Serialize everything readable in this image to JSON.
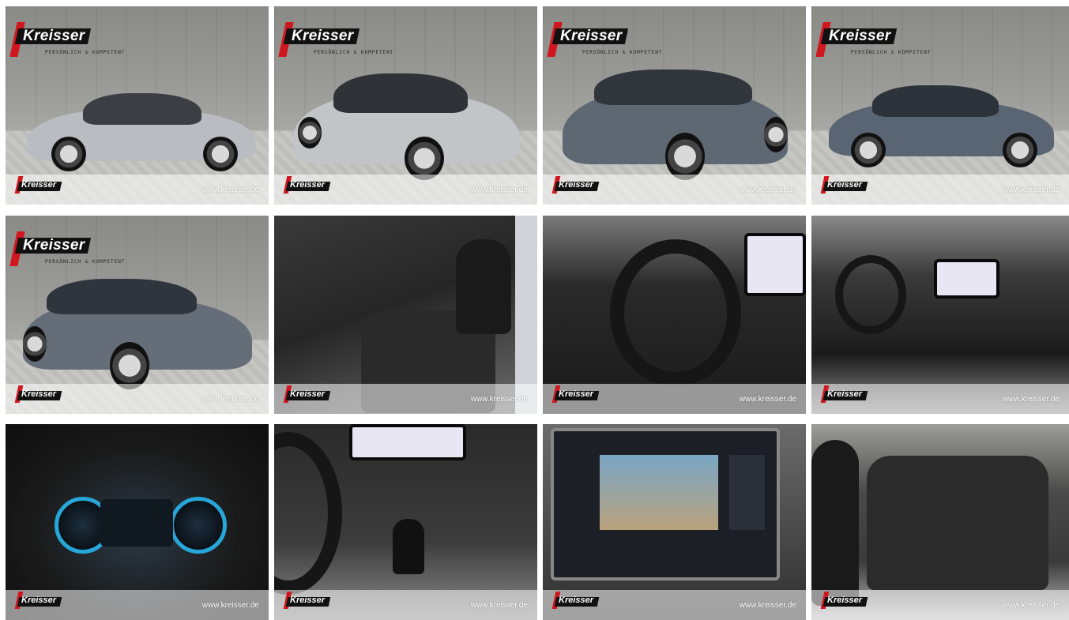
{
  "brand": {
    "logo_text": "Kreisser",
    "slogan": "PERSÖNLICH & KOMPETENT",
    "website": "www.kreisser.de",
    "colors": {
      "red": "#d0161f",
      "black": "#111111"
    }
  },
  "gallery": {
    "tiles": [
      {
        "label": "exterior-side-left"
      },
      {
        "label": "exterior-rear-left"
      },
      {
        "label": "exterior-rear-right"
      },
      {
        "label": "exterior-side-right"
      },
      {
        "label": "exterior-front-left"
      },
      {
        "label": "interior-front-seats"
      },
      {
        "label": "interior-steering-wheel"
      },
      {
        "label": "interior-dashboard"
      },
      {
        "label": "digital-cockpit"
      },
      {
        "label": "center-console"
      },
      {
        "label": "infotainment-rear-camera"
      },
      {
        "label": "interior-rear-seats"
      }
    ]
  }
}
